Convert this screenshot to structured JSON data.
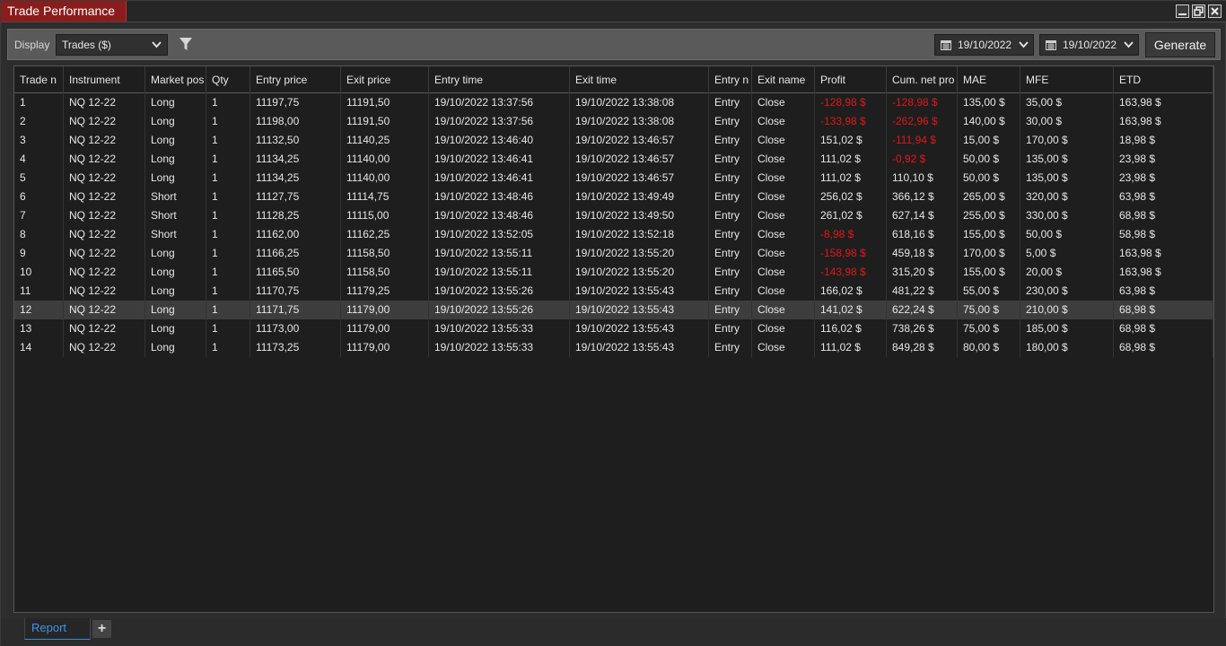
{
  "window": {
    "title": "Trade Performance",
    "controls": {
      "minimize": "minimize-icon",
      "restore": "restore-icon",
      "close": "close-icon"
    }
  },
  "toolbar": {
    "display_label": "Display",
    "display_value": "Trades ($)",
    "from_date": "19/10/2022",
    "to_date": "19/10/2022",
    "generate_label": "Generate"
  },
  "colors": {
    "negative": "#e01818",
    "title_tab": "#8b1c1c",
    "accent": "#3a95e6"
  },
  "table": {
    "columns": [
      "Trade n",
      "Instrument",
      "Market pos",
      "Qty",
      "Entry price",
      "Exit price",
      "Entry time",
      "Exit time",
      "Entry n",
      "Exit name",
      "Profit",
      "Cum. net pro",
      "MAE",
      "MFE",
      "ETD"
    ],
    "selected_row": 12,
    "rows": [
      [
        "1",
        "NQ 12-22",
        "Long",
        "1",
        "11197,75",
        "11191,50",
        "19/10/2022 13:37:56",
        "19/10/2022 13:38:08",
        "Entry",
        "Close",
        "-128,98 $",
        "-128,98 $",
        "135,00 $",
        "35,00 $",
        "163,98 $"
      ],
      [
        "2",
        "NQ 12-22",
        "Long",
        "1",
        "11198,00",
        "11191,50",
        "19/10/2022 13:37:56",
        "19/10/2022 13:38:08",
        "Entry",
        "Close",
        "-133,98 $",
        "-262,96 $",
        "140,00 $",
        "30,00 $",
        "163,98 $"
      ],
      [
        "3",
        "NQ 12-22",
        "Long",
        "1",
        "11132,50",
        "11140,25",
        "19/10/2022 13:46:40",
        "19/10/2022 13:46:57",
        "Entry",
        "Close",
        "151,02 $",
        "-111,94 $",
        "15,00 $",
        "170,00 $",
        "18,98 $"
      ],
      [
        "4",
        "NQ 12-22",
        "Long",
        "1",
        "11134,25",
        "11140,00",
        "19/10/2022 13:46:41",
        "19/10/2022 13:46:57",
        "Entry",
        "Close",
        "111,02 $",
        "-0,92 $",
        "50,00 $",
        "135,00 $",
        "23,98 $"
      ],
      [
        "5",
        "NQ 12-22",
        "Long",
        "1",
        "11134,25",
        "11140,00",
        "19/10/2022 13:46:41",
        "19/10/2022 13:46:57",
        "Entry",
        "Close",
        "111,02 $",
        "110,10 $",
        "50,00 $",
        "135,00 $",
        "23,98 $"
      ],
      [
        "6",
        "NQ 12-22",
        "Short",
        "1",
        "11127,75",
        "11114,75",
        "19/10/2022 13:48:46",
        "19/10/2022 13:49:49",
        "Entry",
        "Close",
        "256,02 $",
        "366,12 $",
        "265,00 $",
        "320,00 $",
        "63,98 $"
      ],
      [
        "7",
        "NQ 12-22",
        "Short",
        "1",
        "11128,25",
        "11115,00",
        "19/10/2022 13:48:46",
        "19/10/2022 13:49:50",
        "Entry",
        "Close",
        "261,02 $",
        "627,14 $",
        "255,00 $",
        "330,00 $",
        "68,98 $"
      ],
      [
        "8",
        "NQ 12-22",
        "Short",
        "1",
        "11162,00",
        "11162,25",
        "19/10/2022 13:52:05",
        "19/10/2022 13:52:18",
        "Entry",
        "Close",
        "-8,98 $",
        "618,16 $",
        "155,00 $",
        "50,00 $",
        "58,98 $"
      ],
      [
        "9",
        "NQ 12-22",
        "Long",
        "1",
        "11166,25",
        "11158,50",
        "19/10/2022 13:55:11",
        "19/10/2022 13:55:20",
        "Entry",
        "Close",
        "-158,98 $",
        "459,18 $",
        "170,00 $",
        "5,00 $",
        "163,98 $"
      ],
      [
        "10",
        "NQ 12-22",
        "Long",
        "1",
        "11165,50",
        "11158,50",
        "19/10/2022 13:55:11",
        "19/10/2022 13:55:20",
        "Entry",
        "Close",
        "-143,98 $",
        "315,20 $",
        "155,00 $",
        "20,00 $",
        "163,98 $"
      ],
      [
        "11",
        "NQ 12-22",
        "Long",
        "1",
        "11170,75",
        "11179,25",
        "19/10/2022 13:55:26",
        "19/10/2022 13:55:43",
        "Entry",
        "Close",
        "166,02 $",
        "481,22 $",
        "55,00 $",
        "230,00 $",
        "63,98 $"
      ],
      [
        "12",
        "NQ 12-22",
        "Long",
        "1",
        "11171,75",
        "11179,00",
        "19/10/2022 13:55:26",
        "19/10/2022 13:55:43",
        "Entry",
        "Close",
        "141,02 $",
        "622,24 $",
        "75,00 $",
        "210,00 $",
        "68,98 $"
      ],
      [
        "13",
        "NQ 12-22",
        "Long",
        "1",
        "11173,00",
        "11179,00",
        "19/10/2022 13:55:33",
        "19/10/2022 13:55:43",
        "Entry",
        "Close",
        "116,02 $",
        "738,26 $",
        "75,00 $",
        "185,00 $",
        "68,98 $"
      ],
      [
        "14",
        "NQ 12-22",
        "Long",
        "1",
        "11173,25",
        "11179,00",
        "19/10/2022 13:55:33",
        "19/10/2022 13:55:43",
        "Entry",
        "Close",
        "111,02 $",
        "849,28 $",
        "80,00 $",
        "180,00 $",
        "68,98 $"
      ]
    ]
  },
  "tabs": {
    "report_label": "Report",
    "add_label": "+"
  }
}
